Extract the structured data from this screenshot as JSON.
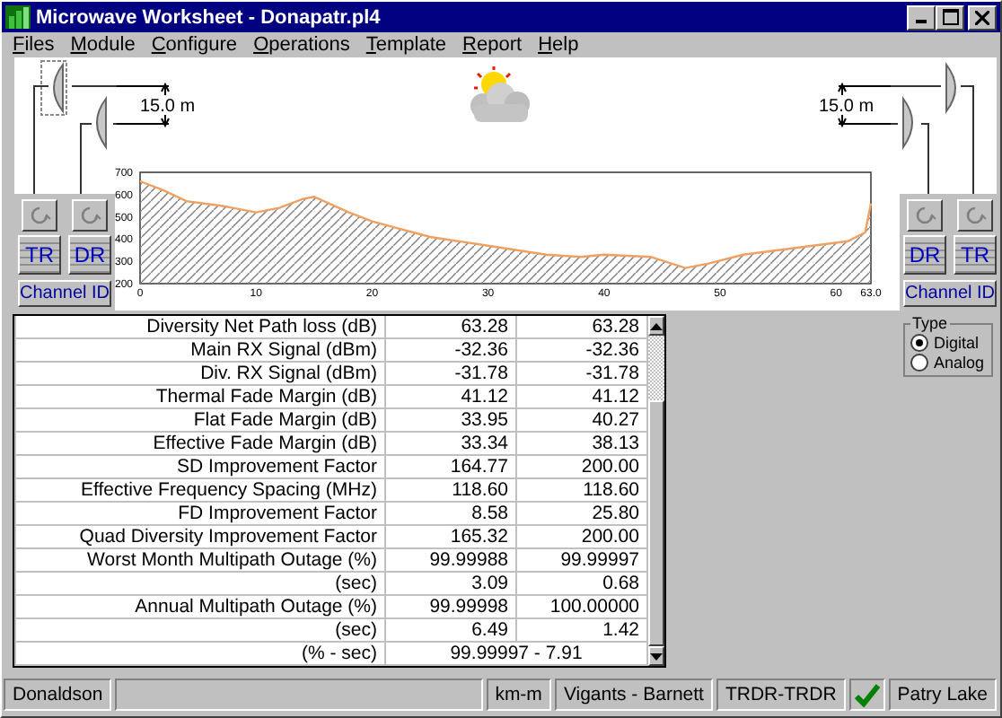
{
  "window": {
    "title": "Microwave Worksheet - Donapatr.pl4"
  },
  "menu": [
    {
      "label": "Files"
    },
    {
      "label": "Module"
    },
    {
      "label": "Configure"
    },
    {
      "label": "Operations"
    },
    {
      "label": "Template"
    },
    {
      "label": "Report"
    },
    {
      "label": "Help"
    }
  ],
  "left_site": {
    "spacing": "15.0 m",
    "buttons": [
      "TR",
      "DR"
    ],
    "channel": "Channel ID"
  },
  "right_site": {
    "spacing": "15.0 m",
    "buttons": [
      "DR",
      "TR"
    ],
    "channel": "Channel ID"
  },
  "profile": {
    "chart_data": {
      "type": "area",
      "x": [
        0,
        2,
        4,
        7,
        10,
        12,
        14,
        15,
        18,
        20,
        25,
        30,
        35,
        38,
        40,
        44,
        47,
        49,
        52,
        55,
        58,
        61,
        62.5,
        63
      ],
      "series": [
        {
          "color": "#f0a060",
          "values": [
            660,
            620,
            570,
            550,
            520,
            540,
            580,
            590,
            520,
            480,
            410,
            370,
            330,
            320,
            330,
            320,
            270,
            290,
            330,
            350,
            370,
            390,
            430,
            560
          ]
        }
      ],
      "xlim": [
        0,
        63
      ],
      "ylim": [
        200,
        700
      ],
      "xticks": [
        0,
        10,
        20,
        30,
        40,
        50,
        60,
        {
          "value": 63,
          "label": "63.0"
        }
      ],
      "yticks": [
        200,
        300,
        400,
        500,
        600,
        700
      ]
    }
  },
  "table": {
    "rows": [
      {
        "label": "Diversity Net Path loss (dB)",
        "values": [
          "63.28",
          "63.28"
        ]
      },
      {
        "label": "Main RX Signal (dBm)",
        "values": [
          "-32.36",
          "-32.36"
        ]
      },
      {
        "label": "Div. RX Signal (dBm)",
        "values": [
          "-31.78",
          "-31.78"
        ]
      },
      {
        "label": "Thermal Fade Margin (dB)",
        "values": [
          "41.12",
          "41.12"
        ]
      },
      {
        "label": "Flat Fade Margin (dB)",
        "values": [
          "33.95",
          "40.27"
        ]
      },
      {
        "label": "Effective Fade Margin (dB)",
        "values": [
          "33.34",
          "38.13"
        ]
      },
      {
        "label": "SD Improvement Factor",
        "values": [
          "164.77",
          "200.00"
        ]
      },
      {
        "label": "Effective Frequency Spacing (MHz)",
        "values": [
          "118.60",
          "118.60"
        ]
      },
      {
        "label": "FD Improvement Factor",
        "values": [
          "8.58",
          "25.80"
        ]
      },
      {
        "label": "Quad Diversity Improvement Factor",
        "values": [
          "165.32",
          "200.00"
        ]
      },
      {
        "label": "Worst Month Multipath Outage (%)",
        "values": [
          "99.99988",
          "99.99997"
        ]
      },
      {
        "label": "(sec)",
        "values": [
          "3.09",
          "0.68"
        ]
      },
      {
        "label": "Annual Multipath Outage (%)",
        "values": [
          "99.99998",
          "100.00000"
        ]
      },
      {
        "label": "(sec)",
        "values": [
          "6.49",
          "1.42"
        ]
      },
      {
        "label": "(% - sec)",
        "values": [
          "99.99997 - 7.91"
        ]
      }
    ]
  },
  "type_group": {
    "title": "Type",
    "options": [
      {
        "label": "Digital",
        "selected": true
      },
      {
        "label": "Analog",
        "selected": false
      }
    ]
  },
  "status_bar": {
    "left": "Donaldson",
    "units": "km-m",
    "method": "Vigants - Barnett",
    "config": "TRDR-TRDR",
    "ok": true,
    "right": "Patry Lake"
  }
}
